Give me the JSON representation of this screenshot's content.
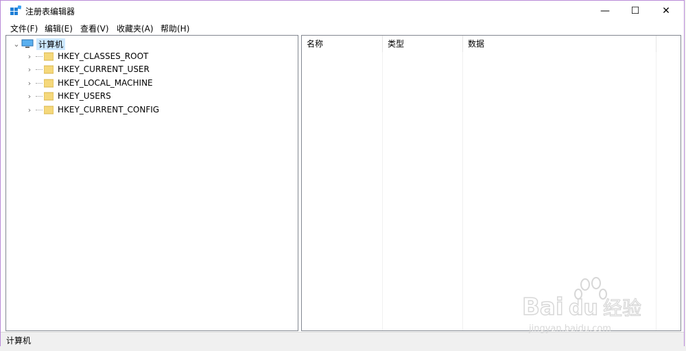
{
  "window": {
    "title": "注册表编辑器",
    "controls": {
      "minimize": "—",
      "maximize": "☐",
      "close": "✕"
    }
  },
  "menu": [
    "文件(F)",
    "编辑(E)",
    "查看(V)",
    "收藏夹(A)",
    "帮助(H)"
  ],
  "tree": {
    "root": "计算机",
    "items": [
      "HKEY_CLASSES_ROOT",
      "HKEY_CURRENT_USER",
      "HKEY_LOCAL_MACHINE",
      "HKEY_USERS",
      "HKEY_CURRENT_CONFIG"
    ]
  },
  "list": {
    "columns": [
      "名称",
      "类型",
      "数据"
    ]
  },
  "status": {
    "path": "计算机"
  },
  "watermark": {
    "brand": "Baidu经验",
    "url": "jingyan.baidu.com"
  },
  "colors": {
    "accent": "#cce8ff",
    "border": "#b98ad8",
    "folder": "#f5d87b"
  }
}
